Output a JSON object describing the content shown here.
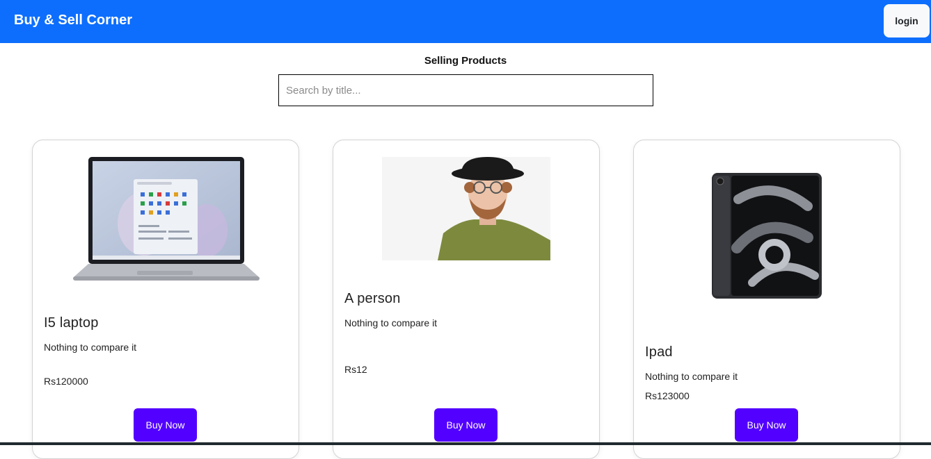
{
  "header": {
    "brand": "Buy & Sell Corner",
    "login_label": "login"
  },
  "section_title": "Selling Products",
  "search": {
    "placeholder": "Search by title...",
    "value": ""
  },
  "products": [
    {
      "title": "I5 laptop",
      "description": "Nothing to compare it",
      "price": "Rs120000",
      "buy_label": "Buy Now",
      "image": "laptop-image"
    },
    {
      "title": "A person",
      "description": "Nothing to compare it",
      "price": "Rs12",
      "buy_label": "Buy Now",
      "image": "person-image"
    },
    {
      "title": "Ipad",
      "description": "Nothing to compare it",
      "price": "Rs123000",
      "buy_label": "Buy Now",
      "image": "ipad-image"
    }
  ],
  "colors": {
    "navbar": "#0d6efd",
    "buy_button": "#5200ff",
    "login_button": "#f8f9fa"
  }
}
